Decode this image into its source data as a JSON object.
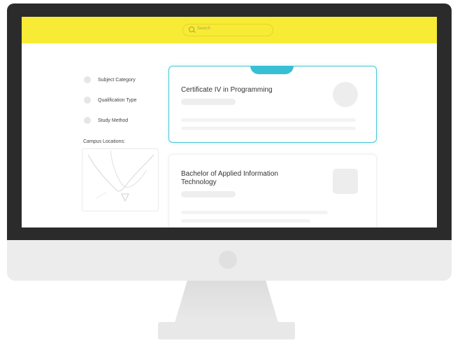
{
  "search": {
    "placeholder": "Search"
  },
  "filters": [
    {
      "label": "Subject Category"
    },
    {
      "label": "Qualification Type"
    },
    {
      "label": "Study Method"
    }
  ],
  "campus": {
    "label": "Campus Locations:"
  },
  "courses": [
    {
      "title": "Certificate IV in Programming",
      "selected": true
    },
    {
      "title": "Bachelor of Applied Information Technology",
      "selected": false
    }
  ],
  "colors": {
    "header": "#f7eb35",
    "accent": "#37bfd4",
    "bezel": "#2b2b2b"
  }
}
